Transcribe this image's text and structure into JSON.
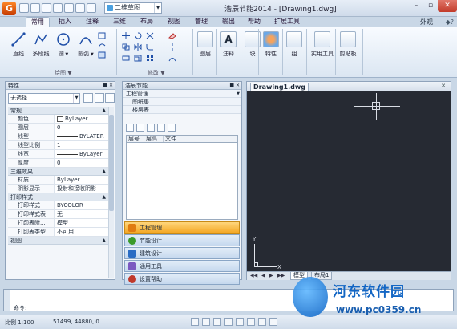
{
  "window": {
    "title": "浩辰节能2014 - [Drawing1.dwg]"
  },
  "quick_access": {
    "workspace": "二维草图"
  },
  "window_controls": {
    "minimize": "–",
    "restore": "▫",
    "close": "✕"
  },
  "ribbon_tabs": [
    {
      "label": "常用",
      "active": true
    },
    {
      "label": "插入"
    },
    {
      "label": "注释"
    },
    {
      "label": "三维"
    },
    {
      "label": "布局"
    },
    {
      "label": "视图"
    },
    {
      "label": "管理"
    },
    {
      "label": "输出"
    },
    {
      "label": "帮助"
    },
    {
      "label": "扩展工具"
    }
  ],
  "appearance": "外观",
  "ribbon": {
    "draw_tools": [
      "直线",
      "多段线",
      "圆",
      "圆弧"
    ],
    "group_draw": "绘图",
    "group_modify": "修改",
    "big_buttons": [
      "图层",
      "注释",
      "块",
      "特性",
      "组",
      "实用工具",
      "剪贴板"
    ]
  },
  "properties_panel": {
    "title": "特性",
    "selection": "无选择",
    "sections": {
      "general": "常规",
      "3d": "三维效果",
      "plot": "打印样式",
      "view": "视图"
    },
    "general_rows": [
      {
        "key": "颜色",
        "value": "ByLayer",
        "kind": "swatch"
      },
      {
        "key": "图层",
        "value": "0"
      },
      {
        "key": "线型",
        "value": "BYLATER",
        "kind": "line"
      },
      {
        "key": "线型比例",
        "value": "1"
      },
      {
        "key": "线宽",
        "value": "ByLayer",
        "kind": "line"
      },
      {
        "key": "厚度",
        "value": "0"
      }
    ],
    "3d_rows": [
      {
        "key": "材质",
        "value": "ByLayer"
      },
      {
        "key": "阴影显示",
        "value": "投射和接收阴影"
      }
    ],
    "plot_rows": [
      {
        "key": "打印样式",
        "value": "BYCOLOR"
      },
      {
        "key": "打印样式表",
        "value": "无"
      },
      {
        "key": "打印表附...",
        "value": "模型"
      },
      {
        "key": "打印表类型",
        "value": "不可用"
      }
    ]
  },
  "project_panel": {
    "title": "浩辰节能",
    "section": "工程管理",
    "tree": [
      "图纸集",
      "楼层表"
    ],
    "columns": [
      "层号",
      "层高",
      "文件"
    ],
    "nav": [
      {
        "label": "工程管理",
        "active": true,
        "color": "#e07b10"
      },
      {
        "label": "节能设计",
        "color": "#3a9a2a"
      },
      {
        "label": "建筑设计",
        "color": "#2a6cc4"
      },
      {
        "label": "通用工具",
        "color": "#7a58c0"
      },
      {
        "label": "设置帮助",
        "color": "#c0392b"
      }
    ]
  },
  "drawing": {
    "tab": "Drawing1.dwg",
    "tab_close": "✕",
    "axis_y": "Y",
    "axis_x": "X",
    "layout_tabs": [
      "模型",
      "布局1"
    ]
  },
  "command": {
    "prompt": "命令:"
  },
  "status": {
    "scale": "比例 1:100",
    "coords": "51499, 44880, 0"
  },
  "watermark": {
    "title": "河东软件园",
    "url": "www.pc0359.cn"
  }
}
